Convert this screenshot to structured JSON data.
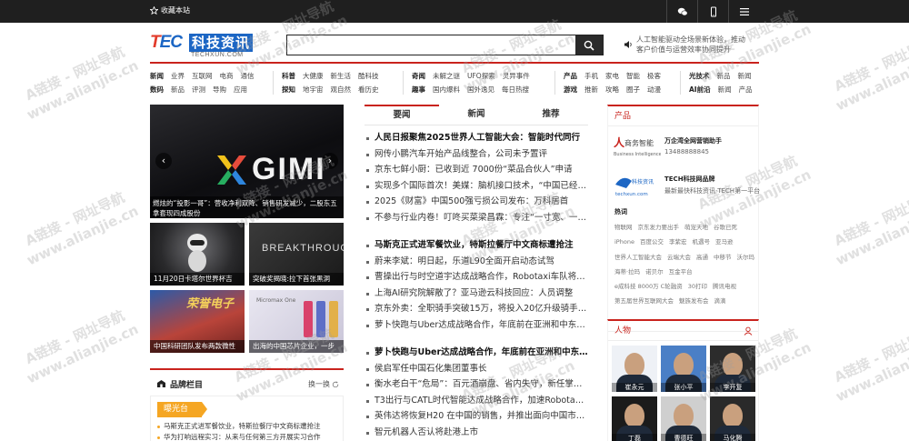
{
  "topbar": {
    "favorite_label": "收藏本站",
    "icons": [
      "wechat-icon",
      "mobile-icon",
      "menu-icon"
    ]
  },
  "logo": {
    "mark_t": "T",
    "mark_ec": "EC",
    "cn": "科技资讯",
    "domain": "TECHXUN.COM"
  },
  "search": {
    "value": "",
    "placeholder": ""
  },
  "notice": {
    "line1": "人工智能驱动全场景新体验，推动",
    "line2": "客户价值与运营效率协同提升"
  },
  "nav": {
    "groups": [
      {
        "rows": [
          [
            "新闻",
            "业界",
            "互联网",
            "电商",
            "通信"
          ],
          [
            "数码",
            "新品",
            "评测",
            "导购",
            "应用"
          ]
        ]
      },
      {
        "rows": [
          [
            "科普",
            "大健康",
            "新生活",
            "酷科技"
          ],
          [
            "探知",
            "地宇宙",
            "观自然",
            "看历史"
          ]
        ]
      },
      {
        "rows": [
          [
            "奇闻",
            "未解之谜",
            "UFO探索",
            "灵异事件"
          ],
          [
            "趣事",
            "国内爆料",
            "国外逸见",
            "每日热搜"
          ]
        ]
      },
      {
        "rows": [
          [
            "产品",
            "手机",
            "家电",
            "智能",
            "极客"
          ],
          [
            "游戏",
            "推新",
            "攻略",
            "圈子",
            "动漫"
          ]
        ]
      },
      {
        "rows": [
          [
            "光技术",
            "新品",
            "新闻"
          ],
          [
            "AI前沿",
            "新闻",
            "产品"
          ]
        ]
      }
    ]
  },
  "hero": {
    "caption": "燃炫的“投影一哥”：营收净利双降、销售研发减少，二股东五拿套现四成股份",
    "brand_text": "GIMI"
  },
  "thumbs": [
    {
      "caption": "11月20日卡塔尔世界杯吉"
    },
    {
      "caption": "突破奖揭晓:拉下首张黑洞",
      "bg_text": "BREAKTHROUGH"
    },
    {
      "caption": "中国科研团队发布两款微性",
      "bg_text": "荣誉电子"
    },
    {
      "caption": "出海的中国芯片企业，一步",
      "bg_text": "Micromax One"
    }
  ],
  "brand": {
    "title": "品牌栏目",
    "swap_label": "换一换",
    "tag": "曝光台",
    "items": [
      "马斯克正式进军餐饮业，特斯拉餐厅中文商标遭抢注",
      "华为打响远程实习：从来与任何第三方开展实习合作"
    ]
  },
  "news_tabs": [
    "要闻",
    "新闻",
    "推荐"
  ],
  "news_blocks": [
    [
      {
        "text": "人民日报聚焦2025世界人工智能大会：智能时代同行",
        "lead": true
      },
      {
        "text": "网传小鹏汽车开始产品线整合，公司未予置评",
        "lead": false
      },
      {
        "text": "京东七鲜小厨：已收到近 7000份“菜品合伙人”申请",
        "lead": false
      },
      {
        "text": "实现多个国际首次！美媒：脑机接口技术，“中国已经领先”",
        "lead": false
      },
      {
        "text": "2025《财富》中国500强亏损公司发布：万科居首",
        "lead": false
      },
      {
        "text": "不参与行业内卷！叮咚买菜梁昌霖：专注“一寸宽、一公里深”",
        "lead": false
      }
    ],
    [
      {
        "text": "马斯克正式进军餐饮业，特斯拉餐厅中文商标遭抢注",
        "lead": true
      },
      {
        "text": "蔚来李斌：明日起，乐道L90全面开启动态试驾",
        "lead": false
      },
      {
        "text": "曹操出行与时空道宇达成战略合作，Robotaxi车队将迎来新动力",
        "lead": false
      },
      {
        "text": "上海AI研究院解散了？亚马逊云科技回应：人员调整",
        "lead": false
      },
      {
        "text": "京东外卖：全职骑手突破15万，将投入20亿升级骑手权益",
        "lead": false
      },
      {
        "text": "萝卜快跑与Uber达成战略合作，年底前在亚洲和中东推出",
        "lead": false
      }
    ],
    [
      {
        "text": "萝卜快跑与Uber达成战略合作，年底前在亚洲和中东推出",
        "lead": true
      },
      {
        "text": "侯启军任中国石化集团董事长",
        "lead": false
      },
      {
        "text": "衡水老白干“危局”：百元酒崩盘、省内失守，新任掌门能否力挽狂澜",
        "lead": false
      },
      {
        "text": "T3出行与CATL时代智能达成战略合作，加速Robotaxi落地",
        "lead": false
      },
      {
        "text": "英伟达将恢复H20 在中国的销售，并推出面向中国市场的新款芯片",
        "lead": false
      },
      {
        "text": "智元机器人否认将赴港上市",
        "lead": false
      }
    ]
  ],
  "products": {
    "title": "产品",
    "items": [
      {
        "name": "万企湾全网营销助手",
        "desc": "13488888845"
      },
      {
        "name": "TECH科技网品牌",
        "desc": "最新最快科技资讯·TECH第一平台"
      }
    ],
    "hot_title": "热词",
    "hot_words": [
      "物联网",
      "京东发力要出手",
      "萌宠天地",
      "谷歌已死",
      "iPhone",
      "百度公交",
      "李紫宏",
      "机遇号",
      "亚马逊",
      "世界人工智能大会",
      "云端大会",
      "高通",
      "中移节",
      "沃尔玛",
      "海蒂·拉玛",
      "诺贝尔",
      "互金平台",
      "e成科技 8000万 C轮融资",
      "30打印",
      "腾讯电视",
      "第五届世界互联网大会",
      "魅族发布会",
      "滴滴"
    ]
  },
  "people": {
    "title": "人物",
    "items": [
      "崔永元",
      "张小平",
      "李开复",
      "丁磊",
      "曹德旺",
      "马化腾"
    ]
  },
  "watermark": {
    "line1": "A链接 - 网址导航",
    "line2": "www.alianjie.cn"
  },
  "colors": {
    "accent_red": "#c9231d",
    "logo_blue": "#1c66c4",
    "tag_orange": "#f5a623"
  }
}
